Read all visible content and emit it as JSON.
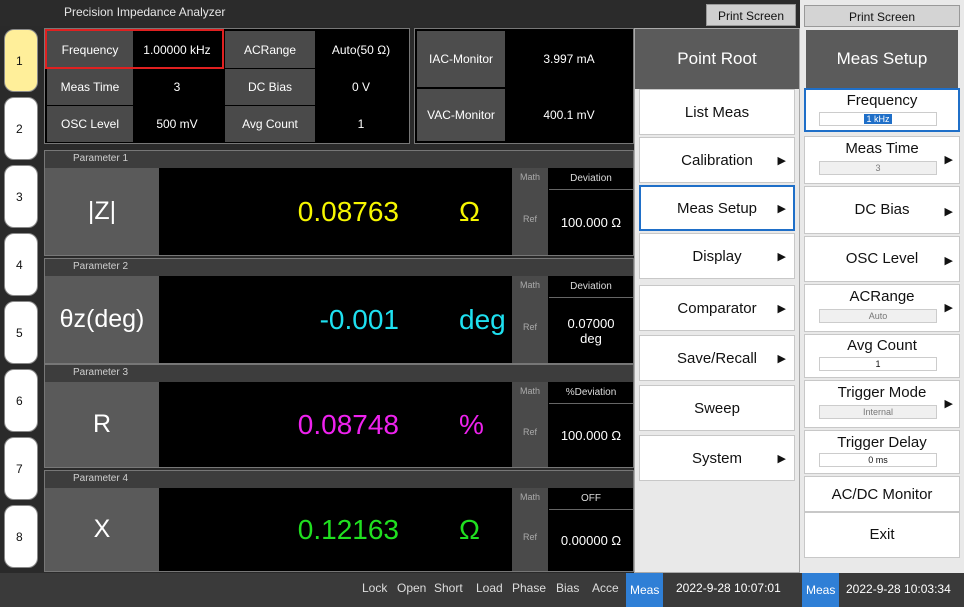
{
  "app_title": "Precision Impedance Analyzer",
  "print_screen_left": "Print Screen",
  "print_screen_right": "Print Screen",
  "tabs": [
    "1",
    "2",
    "3",
    "4",
    "5",
    "6",
    "7",
    "8"
  ],
  "settings": {
    "frequency_label": "Frequency",
    "frequency_value": "1.00000 kHz",
    "acrange_label": "ACRange",
    "acrange_value": "Auto(50 Ω)",
    "meastime_label": "Meas Time",
    "meastime_value": "3",
    "dcbias_label": "DC Bias",
    "dcbias_value": "0 V",
    "osc_label": "OSC Level",
    "osc_value": "500 mV",
    "avg_label": "Avg Count",
    "avg_value": "1"
  },
  "monitor": {
    "iac_label": "IAC-Monitor",
    "iac_value": "3.997 mA",
    "vac_label": "VAC-Monitor",
    "vac_value": "400.1 mV"
  },
  "parameters": [
    {
      "header": "Parameter 1",
      "name": "|Z|",
      "value": "0.08763",
      "unit": "Ω",
      "color": "#f7f700",
      "math": "Math",
      "ref": "Ref",
      "dev_header": "Deviation",
      "dev_value": "100.000 Ω"
    },
    {
      "header": "Parameter 2",
      "name": "θz(deg)",
      "value": "-0.001",
      "unit": "deg",
      "color": "#1ee0f0",
      "math": "Math",
      "ref": "Ref",
      "dev_header": "Deviation",
      "dev_value": "0.07000\ndeg"
    },
    {
      "header": "Parameter 3",
      "name": "R",
      "value": "0.08748",
      "unit": "%",
      "color": "#ee22ee",
      "math": "Math",
      "ref": "Ref",
      "dev_header": "%Deviation",
      "dev_value": "100.000 Ω"
    },
    {
      "header": "Parameter 4",
      "name": "X",
      "value": "0.12163",
      "unit": "Ω",
      "color": "#20e020",
      "math": "Math",
      "ref": "Ref",
      "dev_header": "OFF",
      "dev_value": "0.00000 Ω"
    }
  ],
  "point_root": {
    "title": "Point Root",
    "items": [
      {
        "label": "List Meas",
        "arrow": ""
      },
      {
        "label": "Calibration",
        "arrow": "▶"
      },
      {
        "label": "Meas Setup",
        "arrow": "▶"
      },
      {
        "label": "Display",
        "arrow": "▶"
      },
      {
        "label": "Comparator",
        "arrow": "▶"
      },
      {
        "label": "Save/Recall",
        "arrow": "▶"
      },
      {
        "label": "Sweep",
        "arrow": ""
      },
      {
        "label": "System",
        "arrow": "▶"
      }
    ]
  },
  "meas_setup": {
    "title": "Meas Setup",
    "items": [
      {
        "label": "Frequency",
        "sub": "1 kHz"
      },
      {
        "label": "Meas Time",
        "sub": "3"
      },
      {
        "label": "DC Bias",
        "sub": ""
      },
      {
        "label": "OSC Level",
        "sub": ""
      },
      {
        "label": "ACRange",
        "sub": "Auto"
      },
      {
        "label": "Avg Count",
        "sub": "1"
      },
      {
        "label": "Trigger Mode",
        "sub": "Internal"
      },
      {
        "label": "Trigger Delay",
        "sub": "0 ms"
      },
      {
        "label": "AC/DC Monitor",
        "sub": ""
      },
      {
        "label": "Exit",
        "sub": ""
      }
    ]
  },
  "status": {
    "items": [
      "Lock",
      "Open",
      "Short",
      "Load",
      "Phase",
      "Bias",
      "Acce"
    ],
    "meas": "Meas",
    "datetime_left": "2022-9-28 10:07:01",
    "meas_right": "Meas",
    "datetime_right": "2022-9-28 10:03:34"
  },
  "colors": {
    "accent": "#2f7fd6",
    "highlight_red": "#e02020",
    "active_tab": "#ffef9a"
  }
}
